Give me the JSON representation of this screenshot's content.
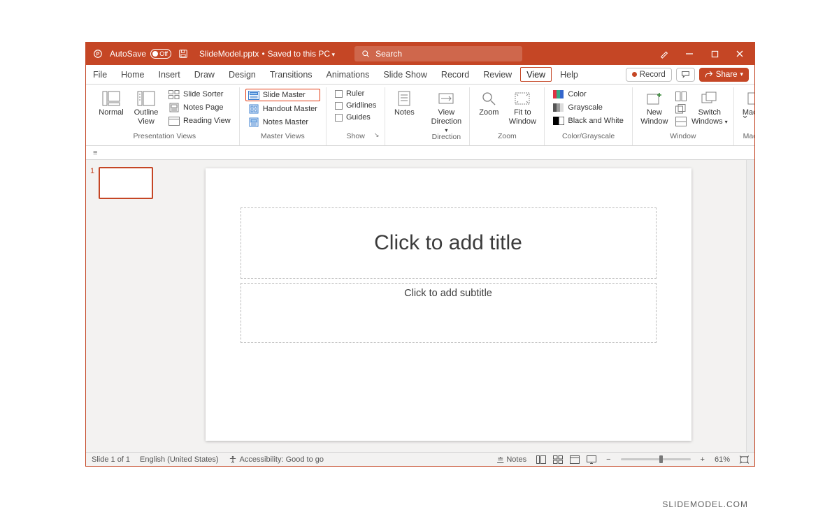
{
  "titlebar": {
    "autosave_label": "AutoSave",
    "autosave_state": "Off",
    "filename": "SlideModel.pptx",
    "saved_status": "Saved to this PC",
    "search_placeholder": "Search"
  },
  "tabs": {
    "file": "File",
    "home": "Home",
    "insert": "Insert",
    "draw": "Draw",
    "design": "Design",
    "transitions": "Transitions",
    "animations": "Animations",
    "slideshow": "Slide Show",
    "record": "Record",
    "review": "Review",
    "view": "View",
    "help": "Help",
    "record_btn": "Record",
    "share_btn": "Share"
  },
  "ribbon": {
    "presentation_views": {
      "label": "Presentation Views",
      "normal": "Normal",
      "outline_view": "Outline\nView",
      "slide_sorter": "Slide Sorter",
      "notes_page": "Notes Page",
      "reading_view": "Reading View"
    },
    "master_views": {
      "label": "Master Views",
      "slide_master": "Slide Master",
      "handout_master": "Handout Master",
      "notes_master": "Notes Master"
    },
    "show": {
      "label": "Show",
      "ruler": "Ruler",
      "gridlines": "Gridlines",
      "guides": "Guides"
    },
    "notes_group": {
      "notes": "Notes"
    },
    "direction_group": {
      "label": "Direction",
      "view_direction": "View\nDirection"
    },
    "zoom_group": {
      "label": "Zoom",
      "zoom": "Zoom",
      "fit": "Fit to\nWindow"
    },
    "color_group": {
      "label": "Color/Grayscale",
      "color": "Color",
      "grayscale": "Grayscale",
      "bw": "Black and White"
    },
    "window_group": {
      "label": "Window",
      "new_window": "New\nWindow",
      "switch_windows": "Switch\nWindows"
    },
    "macros_group": {
      "label": "Macros",
      "macros": "Macros"
    }
  },
  "slide": {
    "number": "1",
    "title_placeholder": "Click to add title",
    "subtitle_placeholder": "Click to add subtitle"
  },
  "statusbar": {
    "slide_count": "Slide 1 of 1",
    "language": "English (United States)",
    "accessibility": "Accessibility: Good to go",
    "notes": "Notes",
    "zoom": "61%"
  },
  "watermark": "SLIDEMODEL.COM"
}
